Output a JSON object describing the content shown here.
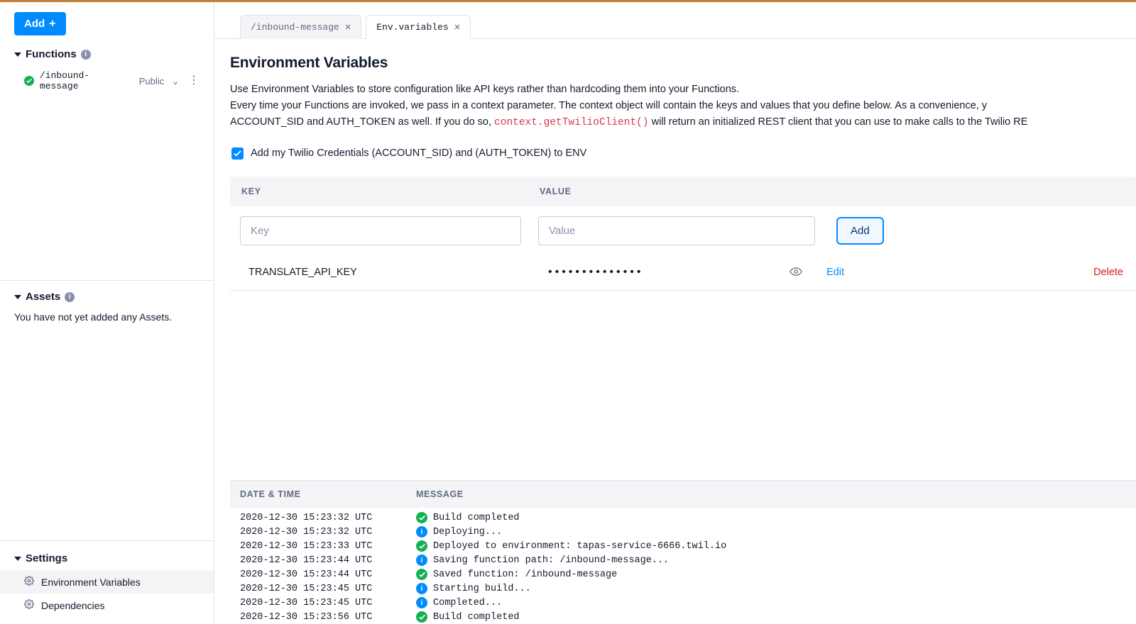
{
  "sidebar": {
    "add_button": "Add",
    "functions_label": "Functions",
    "function_items": [
      {
        "name": "/inbound-message",
        "visibility": "Public"
      }
    ],
    "assets_label": "Assets",
    "assets_empty": "You have not yet added any Assets.",
    "settings_label": "Settings",
    "settings_items": [
      {
        "label": "Environment Variables",
        "active": true
      },
      {
        "label": "Dependencies",
        "active": false
      }
    ]
  },
  "tabs": [
    {
      "label": "/inbound-message",
      "active": false
    },
    {
      "label": "Env.variables",
      "active": true
    }
  ],
  "page": {
    "title": "Environment Variables",
    "desc_line1": "Use Environment Variables to store configuration like API keys rather than hardcoding them into your Functions.",
    "desc_line2_a": "Every time your Functions are invoked, we pass in a context parameter. The context object will contain the keys and values that you define below. As a convenience, y",
    "desc_line3_a": "ACCOUNT_SID and AUTH_TOKEN as well. If you do so, ",
    "desc_line3_code": "context.getTwilioClient()",
    "desc_line3_b": " will return an initialized REST client that you can use to make calls to the Twilio RE",
    "checkbox_label": "Add my Twilio Credentials (ACCOUNT_SID) and (AUTH_TOKEN) to ENV",
    "checkbox_checked": true,
    "col_key": "KEY",
    "col_value": "VALUE",
    "key_placeholder": "Key",
    "value_placeholder": "Value",
    "add_var_button": "Add",
    "vars": [
      {
        "key": "TRANSLATE_API_KEY",
        "masked": "••••••••••••••",
        "edit": "Edit",
        "delete": "Delete"
      }
    ]
  },
  "log": {
    "col_dt": "DATE & TIME",
    "col_msg": "MESSAGE",
    "rows": [
      {
        "dt": "2020-12-30 15:23:32 UTC",
        "type": "success",
        "msg": "Build completed"
      },
      {
        "dt": "2020-12-30 15:23:32 UTC",
        "type": "info",
        "msg": "Deploying..."
      },
      {
        "dt": "2020-12-30 15:23:33 UTC",
        "type": "success",
        "msg": "Deployed to environment: tapas-service-6666.twil.io"
      },
      {
        "dt": "2020-12-30 15:23:44 UTC",
        "type": "info",
        "msg": "Saving function path: /inbound-message..."
      },
      {
        "dt": "2020-12-30 15:23:44 UTC",
        "type": "success",
        "msg": "Saved function: /inbound-message"
      },
      {
        "dt": "2020-12-30 15:23:45 UTC",
        "type": "info",
        "msg": "Starting build..."
      },
      {
        "dt": "2020-12-30 15:23:45 UTC",
        "type": "info",
        "msg": "Completed..."
      },
      {
        "dt": "2020-12-30 15:23:56 UTC",
        "type": "success",
        "msg": "Build completed"
      }
    ]
  }
}
